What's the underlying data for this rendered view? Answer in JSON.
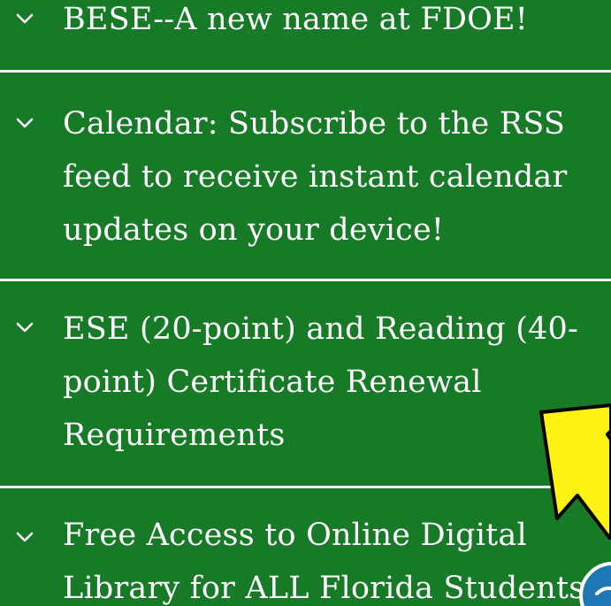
{
  "accordion": {
    "items": [
      {
        "label": "BESE--A new name at FDOE!"
      },
      {
        "label": "Calendar: Subscribe to the RSS feed to receive instant calendar updates on your device!"
      },
      {
        "label": "ESE (20-point) and Reading (40-point) Certificate Renewal Requirements"
      },
      {
        "label": "Free Access to Online Digital Library for ALL Florida Students"
      }
    ]
  },
  "icons": {
    "expand": "chevron-down-icon",
    "pointer": "arrow-pointer-icon",
    "fab": "help-button"
  },
  "colors": {
    "background": "#167a27",
    "text": "#ffffff",
    "divider": "#ffffff",
    "pointer_fill": "#fdf312",
    "fab": "#1f77b4"
  }
}
